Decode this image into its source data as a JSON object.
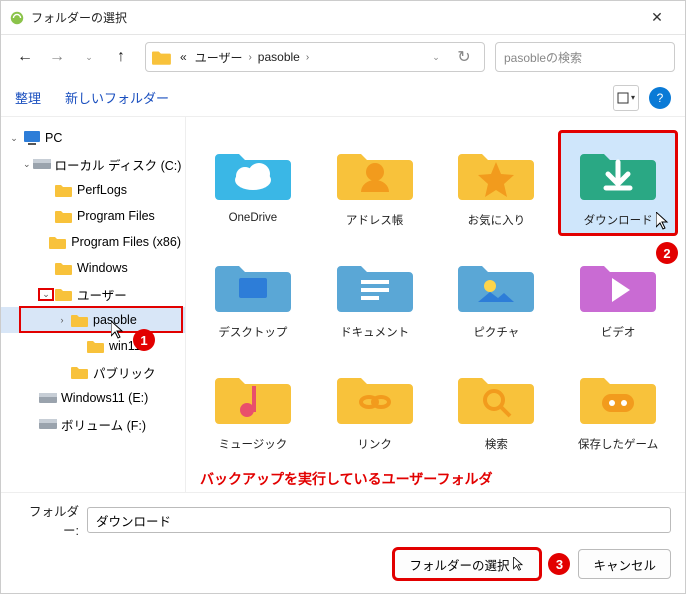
{
  "window": {
    "title": "フォルダーの選択"
  },
  "nav": {
    "crumb_chip": "«",
    "crumbs": [
      "ユーザー",
      "pasoble"
    ],
    "search_placeholder": "pasobleの検索"
  },
  "toolbar": {
    "organize": "整理",
    "new_folder": "新しいフォルダー"
  },
  "tree": [
    {
      "indent": 0,
      "chev": "⌄",
      "icon": "pc",
      "label": "PC",
      "selected": false
    },
    {
      "indent": 1,
      "chev": "⌄",
      "icon": "drive",
      "label": "ローカル ディスク (C:)",
      "selected": false
    },
    {
      "indent": 2,
      "chev": "",
      "icon": "folder",
      "label": "PerfLogs",
      "selected": false
    },
    {
      "indent": 2,
      "chev": "",
      "icon": "folder",
      "label": "Program Files",
      "selected": false
    },
    {
      "indent": 2,
      "chev": "",
      "icon": "folder",
      "label": "Program Files (x86)",
      "selected": false
    },
    {
      "indent": 2,
      "chev": "",
      "icon": "folder",
      "label": "Windows",
      "selected": false
    },
    {
      "indent": 2,
      "chev": "⌄",
      "icon": "folder",
      "label": "ユーザー",
      "selected": false,
      "anno_chev": true
    },
    {
      "indent": 3,
      "chev": "›",
      "icon": "folder",
      "label": "pasoble",
      "selected": true,
      "anno_row": true
    },
    {
      "indent": 4,
      "chev": "",
      "icon": "folder",
      "label": "win11",
      "selected": false
    },
    {
      "indent": 3,
      "chev": "",
      "icon": "folder",
      "label": "パブリック",
      "selected": false
    },
    {
      "indent": 1,
      "chev": "",
      "icon": "drive",
      "label": "Windows11 (E:)",
      "selected": false
    },
    {
      "indent": 1,
      "chev": "",
      "icon": "drive",
      "label": "ボリューム (F:)",
      "selected": false
    }
  ],
  "items": [
    {
      "label": "OneDrive",
      "type": "onedrive"
    },
    {
      "label": "アドレス帳",
      "type": "contacts"
    },
    {
      "label": "お気に入り",
      "type": "favorites"
    },
    {
      "label": "ダウンロード",
      "type": "downloads",
      "selected": true,
      "hl": true,
      "cursor": true
    },
    {
      "label": "デスクトップ",
      "type": "desktop"
    },
    {
      "label": "ドキュメント",
      "type": "documents"
    },
    {
      "label": "ピクチャ",
      "type": "pictures"
    },
    {
      "label": "ビデオ",
      "type": "videos",
      "badge": "2"
    },
    {
      "label": "ミュージック",
      "type": "music"
    },
    {
      "label": "リンク",
      "type": "links"
    },
    {
      "label": "検索",
      "type": "search"
    },
    {
      "label": "保存したゲーム",
      "type": "games"
    }
  ],
  "caption": "バックアップを実行しているユーザーフォルダ",
  "footer": {
    "label": "フォルダー:",
    "value": "ダウンロード",
    "select": "フォルダーの選択",
    "cancel": "キャンセル"
  },
  "badges": {
    "tree": "1",
    "button": "3"
  }
}
